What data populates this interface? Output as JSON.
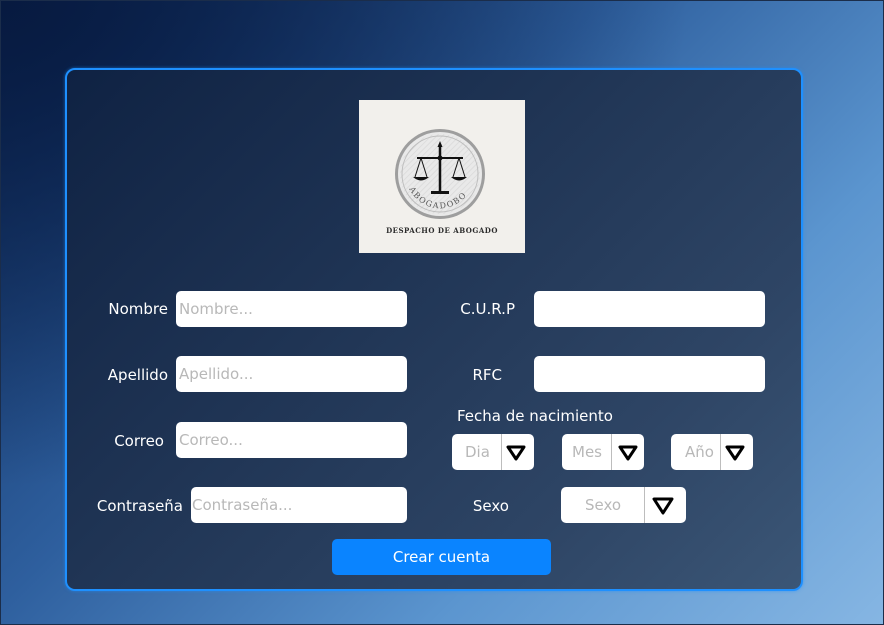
{
  "logo": {
    "ring_text": "ABOGADOBOT",
    "caption": "DESPACHO DE ABOGADO"
  },
  "form": {
    "nombre": {
      "label": "Nombre",
      "placeholder": "Nombre..."
    },
    "apellido": {
      "label": "Apellido",
      "placeholder": "Apellido..."
    },
    "correo": {
      "label": "Correo",
      "placeholder": "Correo..."
    },
    "contrasena": {
      "label": "Contraseña",
      "placeholder": "Contraseña..."
    },
    "curp": {
      "label": "C.U.R.P",
      "placeholder": ""
    },
    "rfc": {
      "label": "RFC",
      "placeholder": ""
    },
    "fecha": {
      "label": "Fecha de nacimiento",
      "dia": "Dia",
      "mes": "Mes",
      "anio": "Año"
    },
    "sexo": {
      "label": "Sexo",
      "value": "Sexo"
    },
    "submit_label": "Crear cuenta"
  },
  "colors": {
    "accent": "#0a84ff",
    "card_border": "#1e90ff"
  },
  "icons": {
    "select_arrow": "triangle-down-outline-icon",
    "logo": "scales-of-justice-icon"
  }
}
